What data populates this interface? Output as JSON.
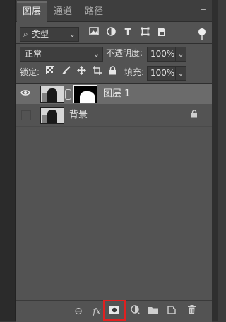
{
  "tabs": [
    {
      "label": "图层"
    },
    {
      "label": "通道"
    },
    {
      "label": "路径"
    }
  ],
  "filter": {
    "kind_label": "类型",
    "search_glyph": "⌕",
    "buttons": [
      "image-filter-icon",
      "adjustment-filter-icon",
      "type-filter-icon",
      "shape-filter-icon",
      "smart-object-filter-icon"
    ],
    "type_glyph": "T"
  },
  "blend": {
    "mode": "正常",
    "opacity_label": "不透明度:",
    "opacity_value": "100%"
  },
  "lock": {
    "label": "锁定:",
    "fill_label": "填充:",
    "fill_value": "100%"
  },
  "layers": [
    {
      "name": "图层 1",
      "visible": true,
      "selected": true,
      "has_mask": true
    },
    {
      "name": "背景",
      "visible": false,
      "selected": false,
      "locked": true
    }
  ],
  "bottom": {
    "fx_label": "fx",
    "link_glyph": "⊖"
  },
  "colors": {
    "panel": "#535353",
    "selected_row": "#6b6b6b",
    "highlight": "#e02020"
  }
}
